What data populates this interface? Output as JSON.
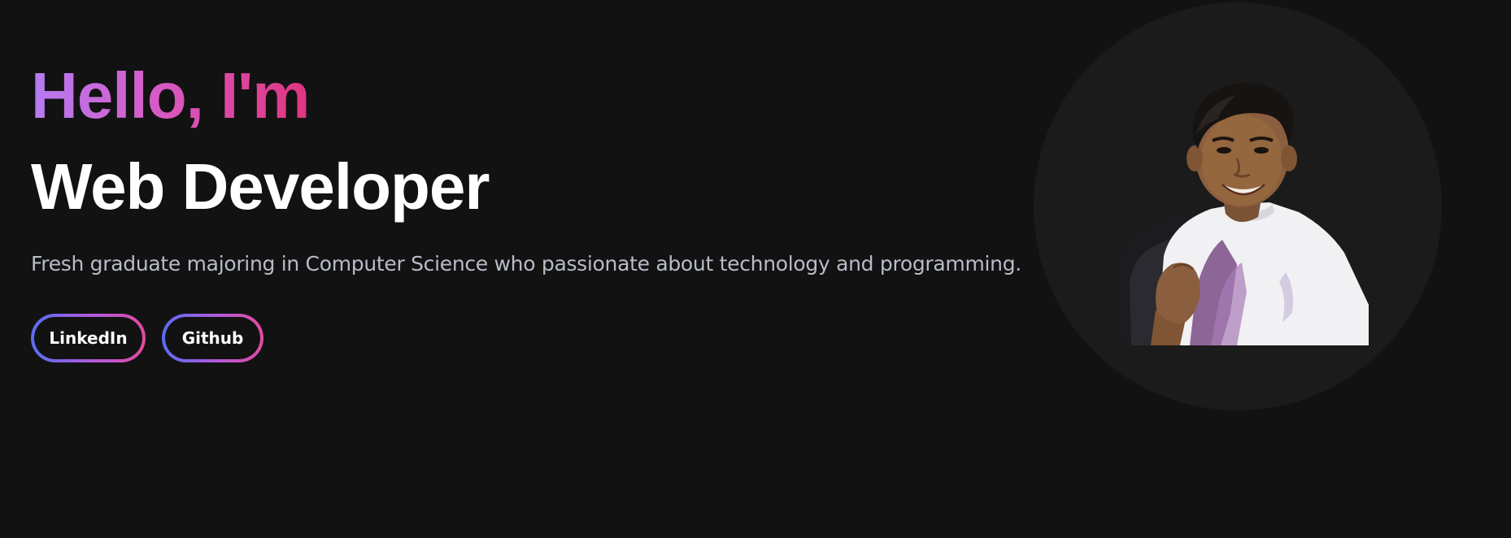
{
  "hero": {
    "greeting": "Hello, I'm",
    "role": "Web Developer",
    "bio": "Fresh graduate majoring in Computer Science who passionate about technology and programming.",
    "buttons": [
      {
        "label": "LinkedIn"
      },
      {
        "label": "Github"
      }
    ],
    "photo": {
      "icon": "profile-portrait",
      "alt": ""
    }
  },
  "colors": {
    "background": "#121212",
    "circle": "#1b1b1b",
    "greeting_gradient": [
      "#b57cf3",
      "#d65bc5",
      "#e0357f"
    ],
    "button_border_gradient": [
      "#5b6cf2",
      "#b25ad8",
      "#e24aa0"
    ],
    "text_primary": "#ffffff",
    "text_secondary": "#b8bcc8"
  }
}
